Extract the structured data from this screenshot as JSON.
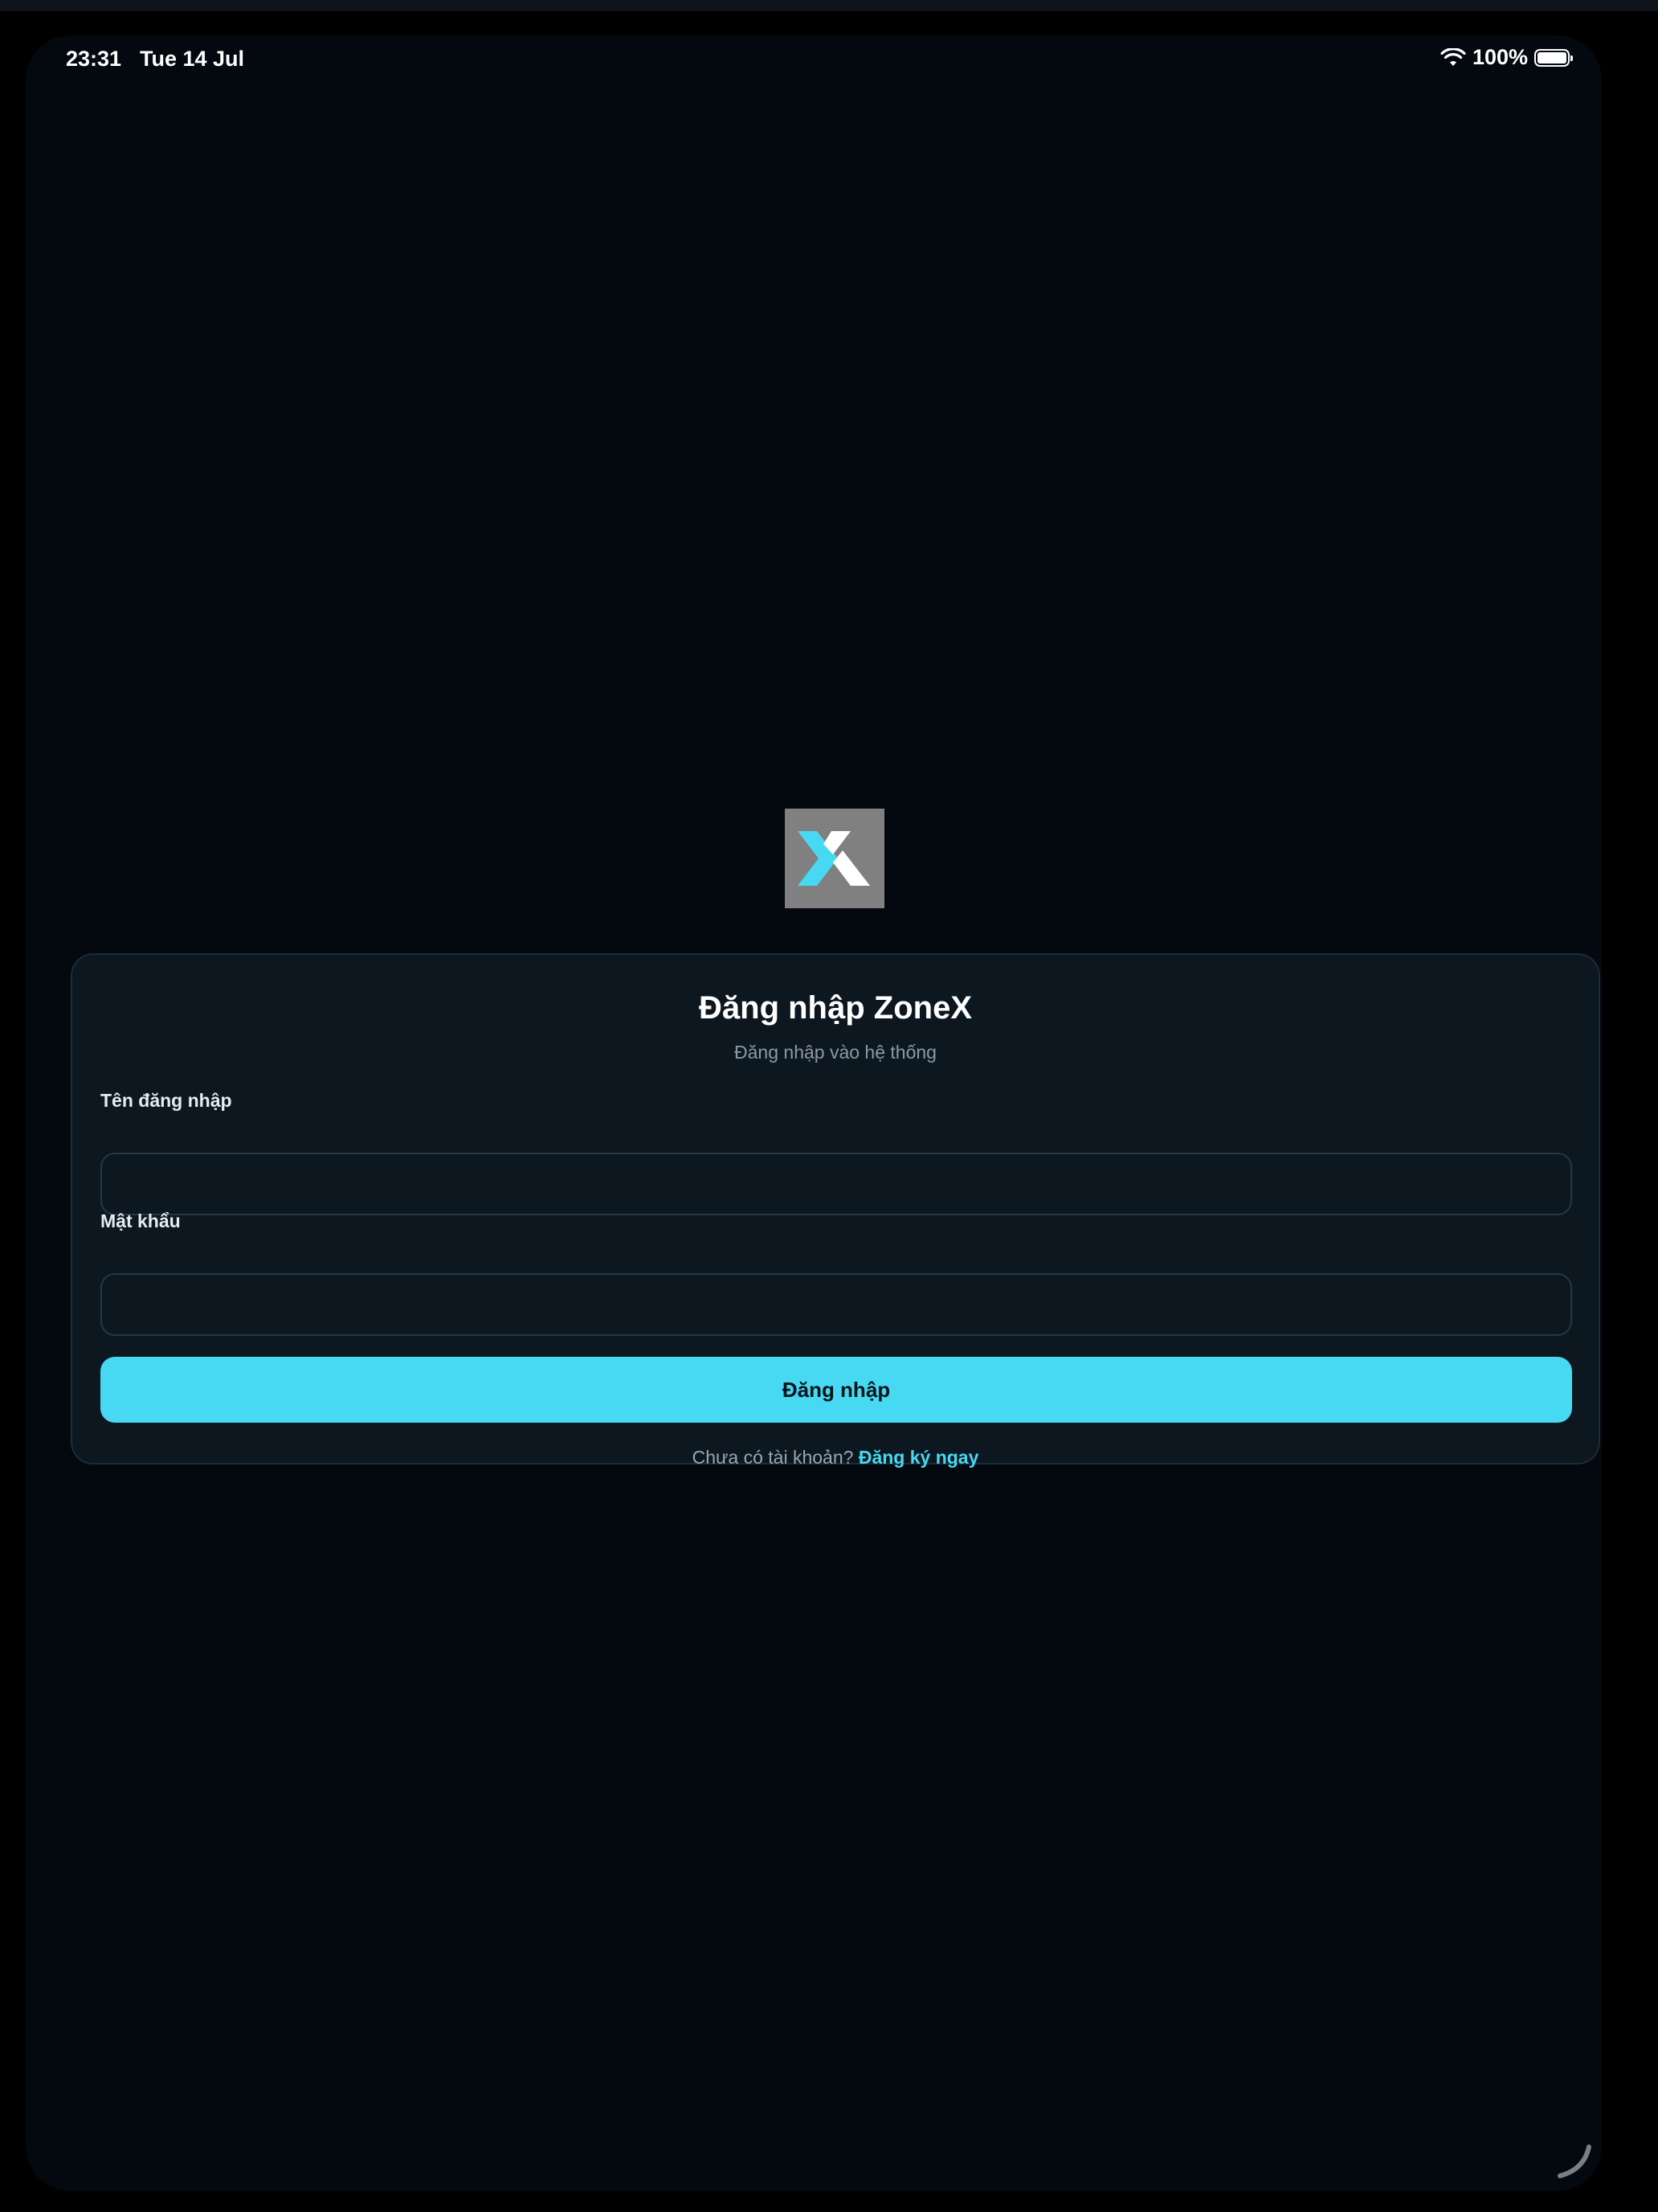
{
  "status_bar": {
    "time": "23:31",
    "date": "Tue 14 Jul",
    "battery_percent": "100%",
    "battery_level": 1.0,
    "wifi_icon": "wifi-icon",
    "battery_icon": "battery-icon"
  },
  "logo": {
    "icon": "zonex-logo",
    "colors": {
      "background": "#808080",
      "accent": "#48d9f2",
      "white": "#ffffff"
    }
  },
  "login": {
    "title": "Đăng nhập ZoneX",
    "subtitle": "Đăng nhập vào hệ thống",
    "username_label": "Tên đăng nhập",
    "username_value": "",
    "password_label": "Mật khẩu",
    "password_value": "",
    "submit_label": "Đăng nhập",
    "no_account_text": "Chưa có tài khoản?",
    "signup_link": "Đăng ký ngay"
  },
  "colors": {
    "background": "#03090f",
    "card": "#0c1720",
    "accent": "#48d9f2",
    "text_primary": "#ffffff",
    "text_secondary": "#8c9aa5"
  }
}
